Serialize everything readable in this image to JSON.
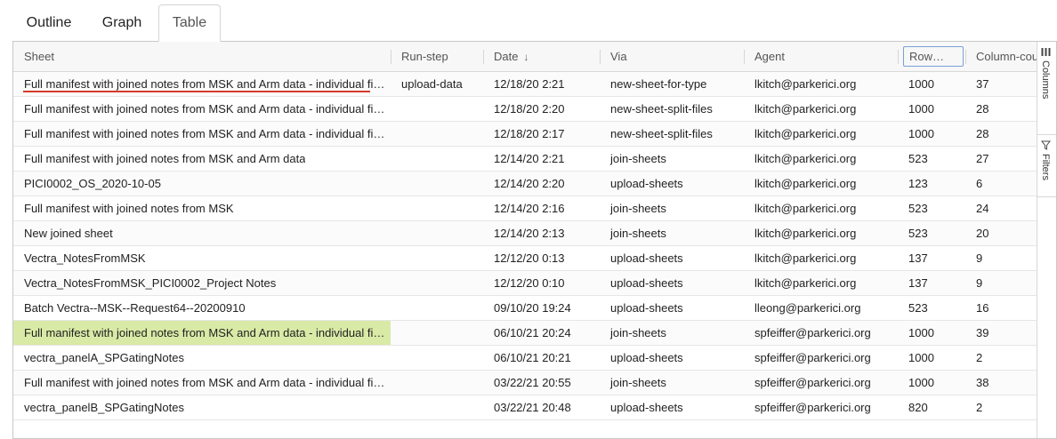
{
  "tabs": [
    {
      "label": "Outline",
      "active": false
    },
    {
      "label": "Graph",
      "active": false
    },
    {
      "label": "Table",
      "active": true
    }
  ],
  "columns": {
    "sheet": "Sheet",
    "run_step": "Run-step",
    "date": "Date",
    "date_sort": "↓",
    "via": "Via",
    "agent": "Agent",
    "rows": "Row…",
    "column_count": "Column-cou"
  },
  "side_panel": {
    "columns_label": "Columns",
    "filters_label": "Filters",
    "columns_icon": "columns-icon",
    "filters_icon": "filter-icon"
  },
  "rows": [
    {
      "sheet": "Full manifest with joined notes from MSK and Arm data - individual fil...",
      "run_step": "upload-data",
      "date": "12/18/20 2:21",
      "via": "new-sheet-for-type",
      "agent": "lkitch@parkerici.org",
      "rows": "1000",
      "column_count": "37"
    },
    {
      "sheet": "Full manifest with joined notes from MSK and Arm data - individual fil...",
      "run_step": "",
      "date": "12/18/20 2:20",
      "via": "new-sheet-split-files",
      "agent": "lkitch@parkerici.org",
      "rows": "1000",
      "column_count": "28"
    },
    {
      "sheet": "Full manifest with joined notes from MSK and Arm data - individual fil...",
      "run_step": "",
      "date": "12/18/20 2:17",
      "via": "new-sheet-split-files",
      "agent": "lkitch@parkerici.org",
      "rows": "1000",
      "column_count": "28"
    },
    {
      "sheet": "Full manifest with joined notes from MSK and Arm data",
      "run_step": "",
      "date": "12/14/20 2:21",
      "via": "join-sheets",
      "agent": "lkitch@parkerici.org",
      "rows": "523",
      "column_count": "27"
    },
    {
      "sheet": "PICI0002_OS_2020-10-05",
      "run_step": "",
      "date": "12/14/20 2:20",
      "via": "upload-sheets",
      "agent": "lkitch@parkerici.org",
      "rows": "123",
      "column_count": "6"
    },
    {
      "sheet": "Full manifest with joined notes from MSK",
      "run_step": "",
      "date": "12/14/20 2:16",
      "via": "join-sheets",
      "agent": "lkitch@parkerici.org",
      "rows": "523",
      "column_count": "24"
    },
    {
      "sheet": "New joined sheet",
      "run_step": "",
      "date": "12/14/20 2:13",
      "via": "join-sheets",
      "agent": "lkitch@parkerici.org",
      "rows": "523",
      "column_count": "20"
    },
    {
      "sheet": "Vectra_NotesFromMSK",
      "run_step": "",
      "date": "12/12/20 0:13",
      "via": "upload-sheets",
      "agent": "lkitch@parkerici.org",
      "rows": "137",
      "column_count": "9"
    },
    {
      "sheet": "Vectra_NotesFromMSK_PICI0002_Project Notes",
      "run_step": "",
      "date": "12/12/20 0:10",
      "via": "upload-sheets",
      "agent": "lkitch@parkerici.org",
      "rows": "137",
      "column_count": "9"
    },
    {
      "sheet": "Batch Vectra--MSK--Request64--20200910",
      "run_step": "",
      "date": "09/10/20 19:24",
      "via": "upload-sheets",
      "agent": "lleong@parkerici.org",
      "rows": "523",
      "column_count": "16"
    },
    {
      "sheet": "Full manifest with joined notes from MSK and Arm data - individual fil...",
      "run_step": "",
      "date": "06/10/21 20:24",
      "via": "join-sheets",
      "agent": "spfeiffer@parkerici.org",
      "rows": "1000",
      "column_count": "39"
    },
    {
      "sheet": "vectra_panelA_SPGatingNotes",
      "run_step": "",
      "date": "06/10/21 20:21",
      "via": "upload-sheets",
      "agent": "spfeiffer@parkerici.org",
      "rows": "1000",
      "column_count": "2"
    },
    {
      "sheet": "Full manifest with joined notes from MSK and Arm data - individual fil...",
      "run_step": "",
      "date": "03/22/21 20:55",
      "via": "join-sheets",
      "agent": "spfeiffer@parkerici.org",
      "rows": "1000",
      "column_count": "38"
    },
    {
      "sheet": "vectra_panelB_SPGatingNotes",
      "run_step": "",
      "date": "03/22/21 20:48",
      "via": "upload-sheets",
      "agent": "spfeiffer@parkerici.org",
      "rows": "820",
      "column_count": "2"
    }
  ],
  "colors": {
    "highlight": "#d9eaa6",
    "underline": "#d63a2c",
    "focus_border": "#7aa0d6"
  }
}
